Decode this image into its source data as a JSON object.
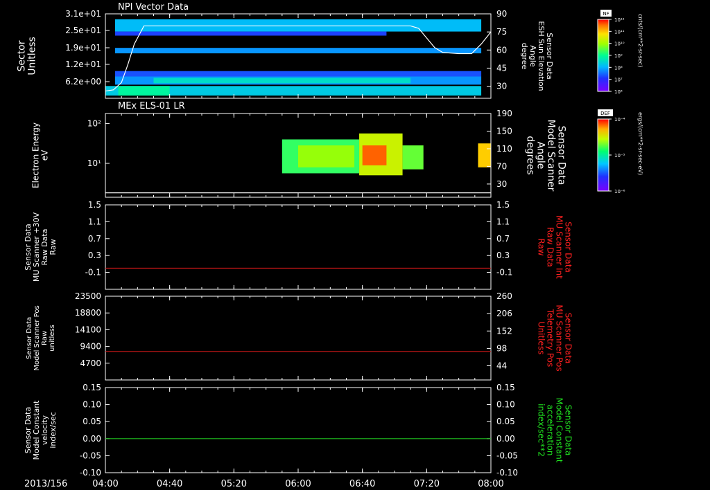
{
  "page": {
    "date": "2013/156"
  },
  "time_axis": {
    "ticks": [
      "04:00",
      "04:40",
      "05:20",
      "06:00",
      "06:40",
      "07:20",
      "08:00"
    ],
    "minor_per_major": 4
  },
  "colorbars": [
    {
      "name": "colorbar-nf",
      "badge": "NF",
      "unit": "cnts/(cm**2-sr-sec)",
      "ticks": [
        "10¹²",
        "10¹¹",
        "10¹⁰",
        "10⁹",
        "10⁸",
        "10⁷",
        "10⁶"
      ]
    },
    {
      "name": "colorbar-def",
      "badge": "DEF",
      "unit": "ergs/(cm**2-sr-sec-eV)",
      "ticks": [
        "10⁻⁴",
        "10⁻⁵",
        "10⁻⁶"
      ]
    }
  ],
  "chart_data": [
    {
      "type": "heatmap",
      "title": "NPI Vector Data",
      "ylabel": [
        "Sector",
        "Unitless"
      ],
      "yticks": [
        "3.1e+01",
        "2.5e+01",
        "1.9e+01",
        "1.2e+01",
        "6.2e+00"
      ],
      "y2label": [
        "Sensor Data",
        "ESH Sun Elevation",
        "Angle",
        "degree"
      ],
      "y2ticks": [
        "90",
        "75",
        "60",
        "45",
        "30"
      ],
      "y2lim": [
        20,
        90
      ],
      "overlay": {
        "x": [
          "04:00",
          "04:05",
          "04:10",
          "04:14",
          "04:18",
          "04:24",
          "07:10",
          "07:15",
          "07:20",
          "07:25",
          "07:30",
          "07:40",
          "07:48",
          "07:54",
          "08:00"
        ],
        "y": [
          26,
          27,
          33,
          48,
          65,
          80,
          80,
          78,
          70,
          62,
          58,
          57,
          57,
          65,
          75
        ]
      },
      "bands": [
        {
          "x": [
            "04:06",
            "07:54"
          ],
          "y": [
            24.5,
            29.0
          ],
          "level": 0.35
        },
        {
          "x": [
            "04:06",
            "06:55"
          ],
          "y": [
            23.0,
            24.5
          ],
          "level": 0.2
        },
        {
          "x": [
            "04:06",
            "07:54"
          ],
          "y": [
            16.5,
            18.5
          ],
          "level": 0.3
        },
        {
          "x": [
            "04:06",
            "07:54"
          ],
          "y": [
            8.0,
            10.0
          ],
          "level": 0.22
        },
        {
          "x": [
            "04:06",
            "07:54"
          ],
          "y": [
            5.0,
            8.0
          ],
          "level": 0.3
        },
        {
          "x": [
            "04:30",
            "07:10"
          ],
          "y": [
            5.5,
            7.5
          ],
          "level": 0.42
        },
        {
          "x": [
            "04:00",
            "07:54"
          ],
          "y": [
            1.0,
            4.5
          ],
          "level": 0.38
        },
        {
          "x": [
            "04:08",
            "04:40"
          ],
          "y": [
            1.0,
            4.5
          ],
          "level": 0.48
        }
      ]
    },
    {
      "type": "heatmap",
      "title": "MEx ELS-01 LR",
      "ylabel": [
        "Electron Energy",
        "eV"
      ],
      "yticks": [
        "10²",
        "10¹"
      ],
      "ylim_log": [
        0.15,
        2.25
      ],
      "y2label": [
        "Sensor Data",
        "Model Scanner",
        "Angle",
        "degrees"
      ],
      "y2ticks": [
        "190",
        "150",
        "110",
        "70",
        "30"
      ],
      "y2lim": [
        0,
        190
      ],
      "overlay": {
        "x": [
          "04:00",
          "08:00"
        ],
        "y": [
          10,
          10
        ]
      },
      "bands": [
        {
          "x": [
            "05:50",
            "06:38"
          ],
          "y": [
            0.75,
            1.6
          ],
          "level": 0.55
        },
        {
          "x": [
            "06:00",
            "06:35"
          ],
          "y": [
            0.9,
            1.45
          ],
          "level": 0.65
        },
        {
          "x": [
            "06:38",
            "07:05"
          ],
          "y": [
            0.7,
            1.75
          ],
          "level": 0.72
        },
        {
          "x": [
            "06:40",
            "06:55"
          ],
          "y": [
            0.95,
            1.45
          ],
          "level": 0.93
        },
        {
          "x": [
            "07:05",
            "07:18"
          ],
          "y": [
            0.85,
            1.45
          ],
          "level": 0.6
        },
        {
          "x": [
            "07:52",
            "08:00"
          ],
          "y": [
            0.9,
            1.5
          ],
          "level": 0.82
        }
      ]
    },
    {
      "type": "line",
      "ylabel": [
        "Sensor Data",
        "MU Scanner +30V",
        "Raw Data",
        "Raw"
      ],
      "yticks": [
        "1.5",
        "1.1",
        "0.7",
        "0.3",
        "-0.1"
      ],
      "ylim": [
        -0.5,
        1.5
      ],
      "y2label": [
        "Sensor Data",
        "MU Scanner Int",
        "Raw Data",
        "Raw"
      ],
      "y2ticks": [
        "1.5",
        "1.1",
        "0.7",
        "0.3",
        "-0.1"
      ],
      "y2label_color": "#ff2020",
      "line_color": "#d01818",
      "line": {
        "x": [
          "04:00",
          "08:00"
        ],
        "y": [
          0.0,
          0.0
        ]
      }
    },
    {
      "type": "line",
      "ylabel": [
        "Sensor Data",
        "Model Scanner Pos",
        "Raw",
        "unitless"
      ],
      "yticks": [
        "23500",
        "18800",
        "14100",
        "9400",
        "4700"
      ],
      "ylim": [
        0,
        23500
      ],
      "y2label": [
        "Sensor Data",
        "MU Scanner Pos",
        "Telemetry Pos",
        "Unitless"
      ],
      "y2ticks": [
        "260",
        "206",
        "152",
        "98",
        "44"
      ],
      "y2label_color": "#ff2020",
      "line_color": "#d01818",
      "line": {
        "x": [
          "04:00",
          "08:00"
        ],
        "y": [
          8000,
          8000
        ]
      }
    },
    {
      "type": "line",
      "ylabel": [
        "Sensor Data",
        "Model Constant",
        "velocity",
        "index/sec"
      ],
      "yticks": [
        "0.15",
        "0.10",
        "0.05",
        "0.00",
        "-0.05",
        "-0.10"
      ],
      "ylim": [
        -0.1,
        0.15
      ],
      "y2label": [
        "Sensor Data",
        "Model Constant",
        "acceleration",
        "index/sec**2"
      ],
      "y2ticks": [
        "0.15",
        "0.10",
        "0.05",
        "0.00",
        "-0.05",
        "-0.10"
      ],
      "y2label_color": "#20e020",
      "line_color": "#20c020",
      "line": {
        "x": [
          "04:00",
          "08:00"
        ],
        "y": [
          0.0,
          0.0
        ]
      }
    }
  ]
}
